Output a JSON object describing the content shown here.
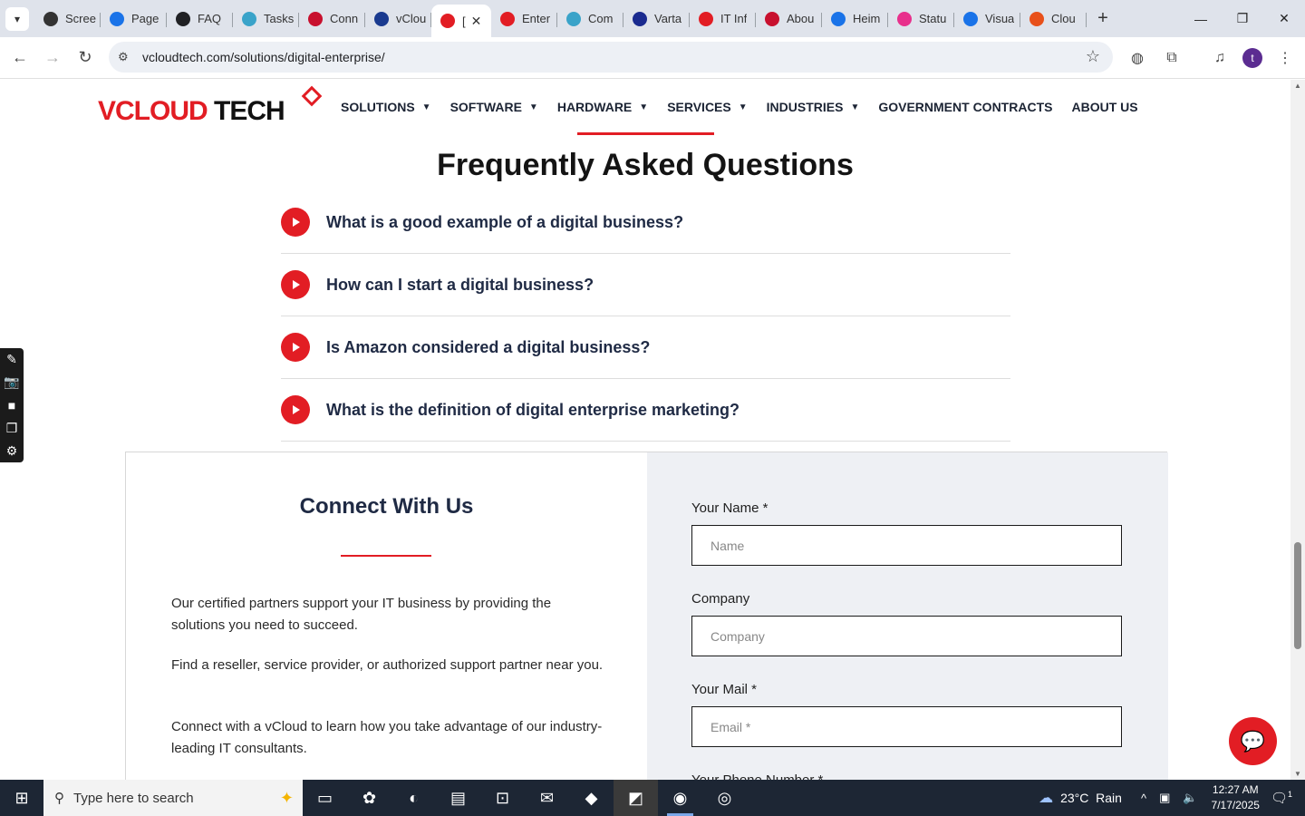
{
  "browser": {
    "tabs": [
      {
        "label": "Scree",
        "color": "#333333"
      },
      {
        "label": "Page",
        "color": "#1a73e8"
      },
      {
        "label": "FAQ",
        "color": "#202124"
      },
      {
        "label": "Tasks",
        "color": "#3aa3c9"
      },
      {
        "label": "Conn",
        "color": "#c8102e"
      },
      {
        "label": "vClou",
        "color": "#1a3a8f"
      },
      {
        "label": "[",
        "color": "#e21d24",
        "active": true
      },
      {
        "label": "Enter",
        "color": "#e21d24"
      },
      {
        "label": "Com",
        "color": "#3aa3c9"
      },
      {
        "label": "Varta",
        "color": "#1a2a8f"
      },
      {
        "label": "IT Inf",
        "color": "#e21d24"
      },
      {
        "label": "Abou",
        "color": "#c8102e"
      },
      {
        "label": "Heim",
        "color": "#1a73e8"
      },
      {
        "label": "Statu",
        "color": "#e8308c"
      },
      {
        "label": "Visua",
        "color": "#1a73e8"
      },
      {
        "label": "Clou",
        "color": "#e8501a"
      }
    ],
    "url": "vcloudtech.com/solutions/digital-enterprise/",
    "profile_initial": "t"
  },
  "site": {
    "logo": {
      "v": "V",
      "cloud": "CLOUD",
      "tech": " TECH"
    },
    "nav": [
      {
        "label": "SOLUTIONS",
        "dropdown": true
      },
      {
        "label": "SOFTWARE",
        "dropdown": true
      },
      {
        "label": "HARDWARE",
        "dropdown": true
      },
      {
        "label": "SERVICES",
        "dropdown": true
      },
      {
        "label": "INDUSTRIES",
        "dropdown": true
      },
      {
        "label": "GOVERNMENT CONTRACTS",
        "dropdown": false
      },
      {
        "label": "ABOUT US",
        "dropdown": false
      }
    ],
    "accent": "#e21d24"
  },
  "faq": {
    "title": "Frequently Asked Questions",
    "items": [
      "What is a good example of a digital business?",
      "How can I start a digital business?",
      "Is Amazon considered a digital business?",
      "What is the definition of digital enterprise marketing?"
    ]
  },
  "connect": {
    "title": "Connect With Us",
    "paragraphs": [
      "Our certified partners support your IT business by providing the solutions you need to succeed.",
      "Find a reseller, service provider, or authorized support partner near you.",
      "Connect with a vCloud to learn how you take advantage of our industry-leading IT consultants."
    ],
    "form": {
      "name_label": "Your Name *",
      "name_placeholder": "Name",
      "company_label": "Company",
      "company_placeholder": "Company",
      "mail_label": "Your Mail *",
      "mail_placeholder": "Email *",
      "phone_label": "Your Phone Number *"
    }
  },
  "taskbar": {
    "search_placeholder": "Type here to search",
    "weather_temp": "23°C",
    "weather_text": "Rain",
    "time": "12:27 AM",
    "date": "7/17/2025",
    "notif_count": "1"
  }
}
